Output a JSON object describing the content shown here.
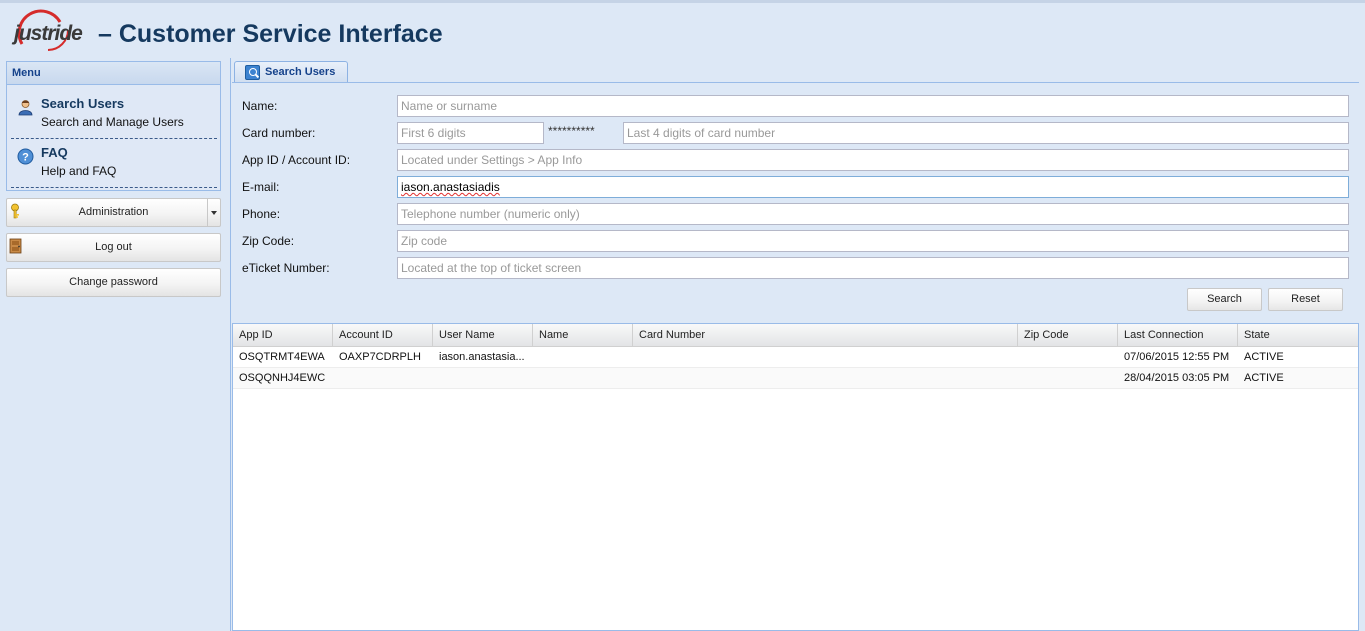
{
  "app": {
    "logo_text": "justride",
    "title": "– Customer Service Interface"
  },
  "menu": {
    "header": "Menu",
    "items": [
      {
        "title": "Search Users",
        "subtitle": "Search and Manage Users",
        "icon": "user-icon"
      },
      {
        "title": "FAQ",
        "subtitle": "Help and FAQ",
        "icon": "help-icon"
      }
    ]
  },
  "side_buttons": {
    "administration": "Administration",
    "logout": "Log out",
    "change_password": "Change password"
  },
  "tab": {
    "label": "Search Users",
    "icon": "search-icon"
  },
  "form": {
    "name": {
      "label": "Name:",
      "placeholder": "Name or surname",
      "value": ""
    },
    "card": {
      "label": "Card number:",
      "first_placeholder": "First 6 digits",
      "mask": "**********",
      "last_placeholder": "Last 4 digits of card number"
    },
    "appid": {
      "label": "App ID / Account ID:",
      "placeholder": "Located under Settings > App Info"
    },
    "email": {
      "label": "E-mail:",
      "value": "iason.anastasiadis"
    },
    "phone": {
      "label": "Phone:",
      "placeholder": "Telephone number (numeric only)"
    },
    "zip": {
      "label": "Zip Code:",
      "placeholder": "Zip code"
    },
    "eticket": {
      "label": "eTicket Number:",
      "placeholder": "Located at the top of ticket screen"
    },
    "search_button": "Search",
    "reset_button": "Reset"
  },
  "grid": {
    "columns": [
      "App ID",
      "Account ID",
      "User Name",
      "Name",
      "Card Number",
      "Zip Code",
      "Last Connection",
      "State"
    ],
    "rows": [
      [
        "OSQTRMT4EWA",
        "OAXP7CDRPLH",
        "iason.anastasia...",
        "",
        "",
        "",
        "07/06/2015 12:55 PM",
        "ACTIVE"
      ],
      [
        "OSQQNHJ4EWC",
        "",
        "",
        "",
        "",
        "",
        "28/04/2015 03:05 PM",
        "ACTIVE"
      ]
    ]
  },
  "colors": {
    "background": "#dde8f6",
    "title": "#15395f",
    "panel_border": "#99bbe8",
    "logo_red": "#d52b2b"
  }
}
